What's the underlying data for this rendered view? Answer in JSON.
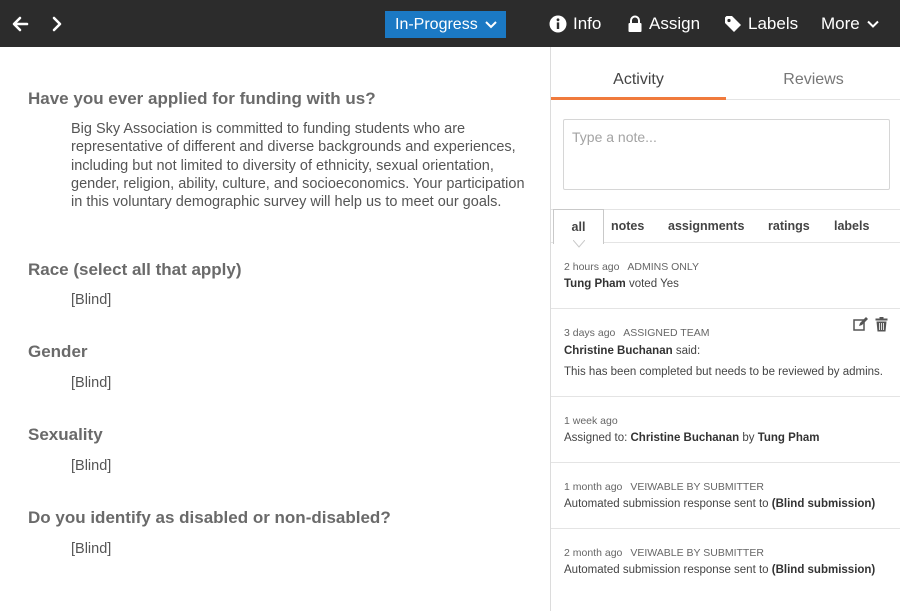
{
  "topbar": {
    "status_label": "In-Progress",
    "info_label": "Info",
    "assign_label": "Assign",
    "labels_label": "Labels",
    "more_label": "More"
  },
  "form": {
    "questions": [
      {
        "question": "Have you ever applied for funding with us?",
        "answer": "Big Sky Association is committed to funding students who are representative of different and diverse backgrounds and experiences, including but not limited to diversity of ethnicity, sexual orientation, gender, religion, ability, culture, and socioeconomics. Your participation in this voluntary demographic survey will help us to meet our goals."
      },
      {
        "question": "Race (select all that apply)",
        "answer": "[Blind]"
      },
      {
        "question": "Gender",
        "answer": "[Blind]"
      },
      {
        "question": "Sexuality",
        "answer": "[Blind]"
      },
      {
        "question": "Do you identify as disabled or non-disabled?",
        "answer": "[Blind]"
      }
    ]
  },
  "activity": {
    "tabs": [
      "Activity",
      "Reviews"
    ],
    "note_placeholder": "Type a note...",
    "filters": [
      "all",
      "notes",
      "assignments",
      "ratings",
      "labels"
    ],
    "entries": [
      {
        "time": "2 hours ago",
        "tag": "ADMINS ONLY",
        "name": "Tung Pham",
        "text": "voted Yes"
      },
      {
        "time": "3 days ago",
        "tag": "ASSIGNED TEAM",
        "name": "Christine Buchanan",
        "text": "said:",
        "body": "This has been completed but needs to be reviewed by admins."
      },
      {
        "time": "1 week ago",
        "prefix": "Assigned to:",
        "name": "Christine Buchanan",
        "by": "by",
        "name2": "Tung Pham"
      },
      {
        "time": "1 month ago",
        "tag": "VEIWABLE BY SUBMITTER",
        "text": "Automated submission response sent to",
        "name": "(Blind submission)"
      },
      {
        "time": "2 month ago",
        "tag": "VEIWABLE BY SUBMITTER",
        "text": "Automated submission response sent to",
        "name": "(Blind submission)"
      }
    ]
  },
  "colors": {
    "topbar": "#2c2c2c",
    "status_button": "#1b79c4",
    "tab_accent": "#f07a3c"
  }
}
